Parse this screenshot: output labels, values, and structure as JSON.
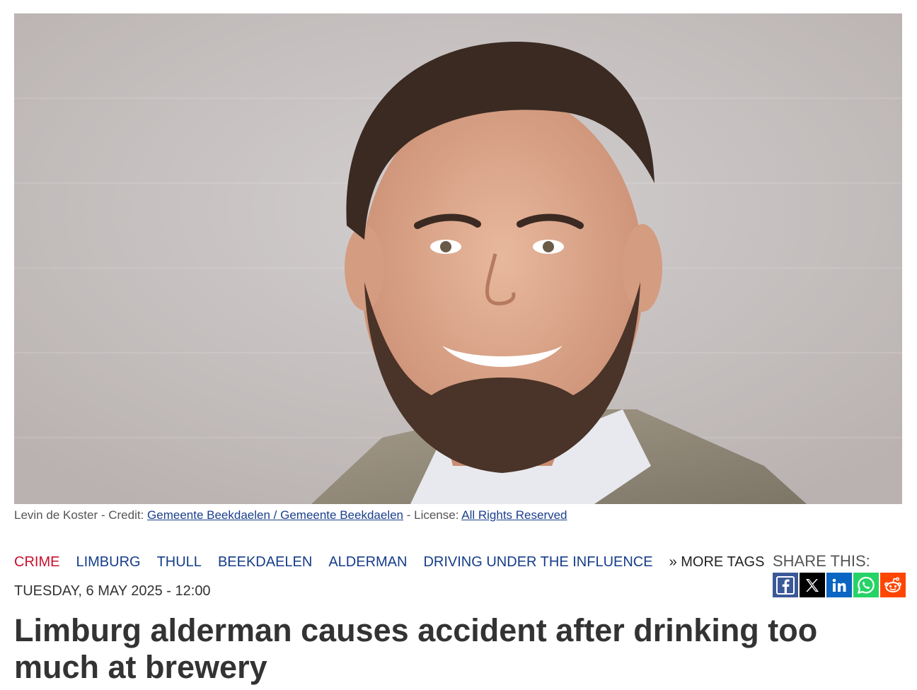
{
  "hero": {
    "image_name": "portrait-photo"
  },
  "caption": {
    "prefix": "Levin de Koster - Credit: ",
    "credit_link": "Gemeente Beekdaelen / Gemeente Beekdaelen",
    "license_prefix": " - License: ",
    "license_link": "All Rights Reserved"
  },
  "tags": [
    {
      "label": "CRIME",
      "color": "#c8102e"
    },
    {
      "label": "LIMBURG",
      "color": "#153d8a"
    },
    {
      "label": "THULL",
      "color": "#153d8a"
    },
    {
      "label": "BEEKDAELEN",
      "color": "#153d8a"
    },
    {
      "label": "ALDERMAN",
      "color": "#153d8a"
    },
    {
      "label": "DRIVING UNDER THE INFLUENCE",
      "color": "#153d8a"
    }
  ],
  "more_tags": "» MORE TAGS",
  "share": {
    "label": "SHARE THIS:",
    "buttons": [
      {
        "icon": "facebook-icon",
        "color": "#3b5998"
      },
      {
        "icon": "x-icon",
        "color": "#000000"
      },
      {
        "icon": "linkedin-icon",
        "color": "#0a66c2"
      },
      {
        "icon": "whatsapp-icon",
        "color": "#25d366"
      },
      {
        "icon": "reddit-icon",
        "color": "#ff4500"
      }
    ]
  },
  "article": {
    "date": "TUESDAY, 6 MAY 2025 - 12:00",
    "headline": "Limburg alderman causes accident after drinking too much at brewery"
  }
}
